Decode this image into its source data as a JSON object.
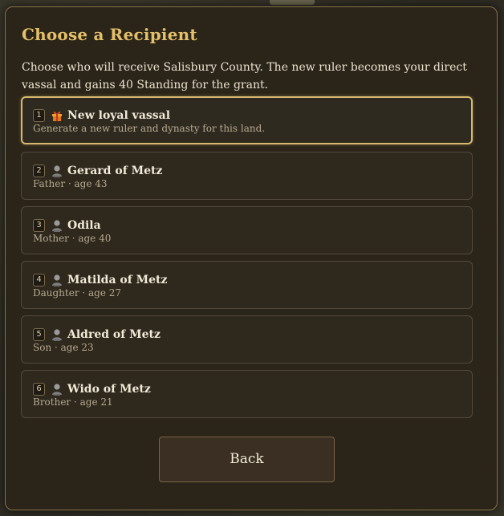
{
  "dialog": {
    "title": "Choose a Recipient",
    "description": "Choose who will receive Salisbury County. The new ruler becomes your direct vassal and gains 40 Standing for the grant.",
    "back_label": "Back"
  },
  "options": [
    {
      "num": "1",
      "icon": "gift-icon",
      "name": "New loyal vassal",
      "subtitle": "Generate a new ruler and dynasty for this land.",
      "selected": true
    },
    {
      "num": "2",
      "icon": "person-bust-icon",
      "name": "Gerard of Metz",
      "subtitle": "Father · age 43",
      "selected": false
    },
    {
      "num": "3",
      "icon": "person-bust-icon",
      "name": "Odila",
      "subtitle": "Mother · age 40",
      "selected": false
    },
    {
      "num": "4",
      "icon": "person-bust-icon",
      "name": "Matilda of Metz",
      "subtitle": "Daughter · age 27",
      "selected": false
    },
    {
      "num": "5",
      "icon": "person-bust-icon",
      "name": "Aldred of Metz",
      "subtitle": "Son · age 23",
      "selected": false
    },
    {
      "num": "6",
      "icon": "person-bust-icon",
      "name": "Wido of Metz",
      "subtitle": "Brother · age 21",
      "selected": false
    }
  ],
  "colors": {
    "title_gold": "#e5c06b",
    "selected_border": "#d6b86e",
    "panel_bg": "#2a2419"
  }
}
